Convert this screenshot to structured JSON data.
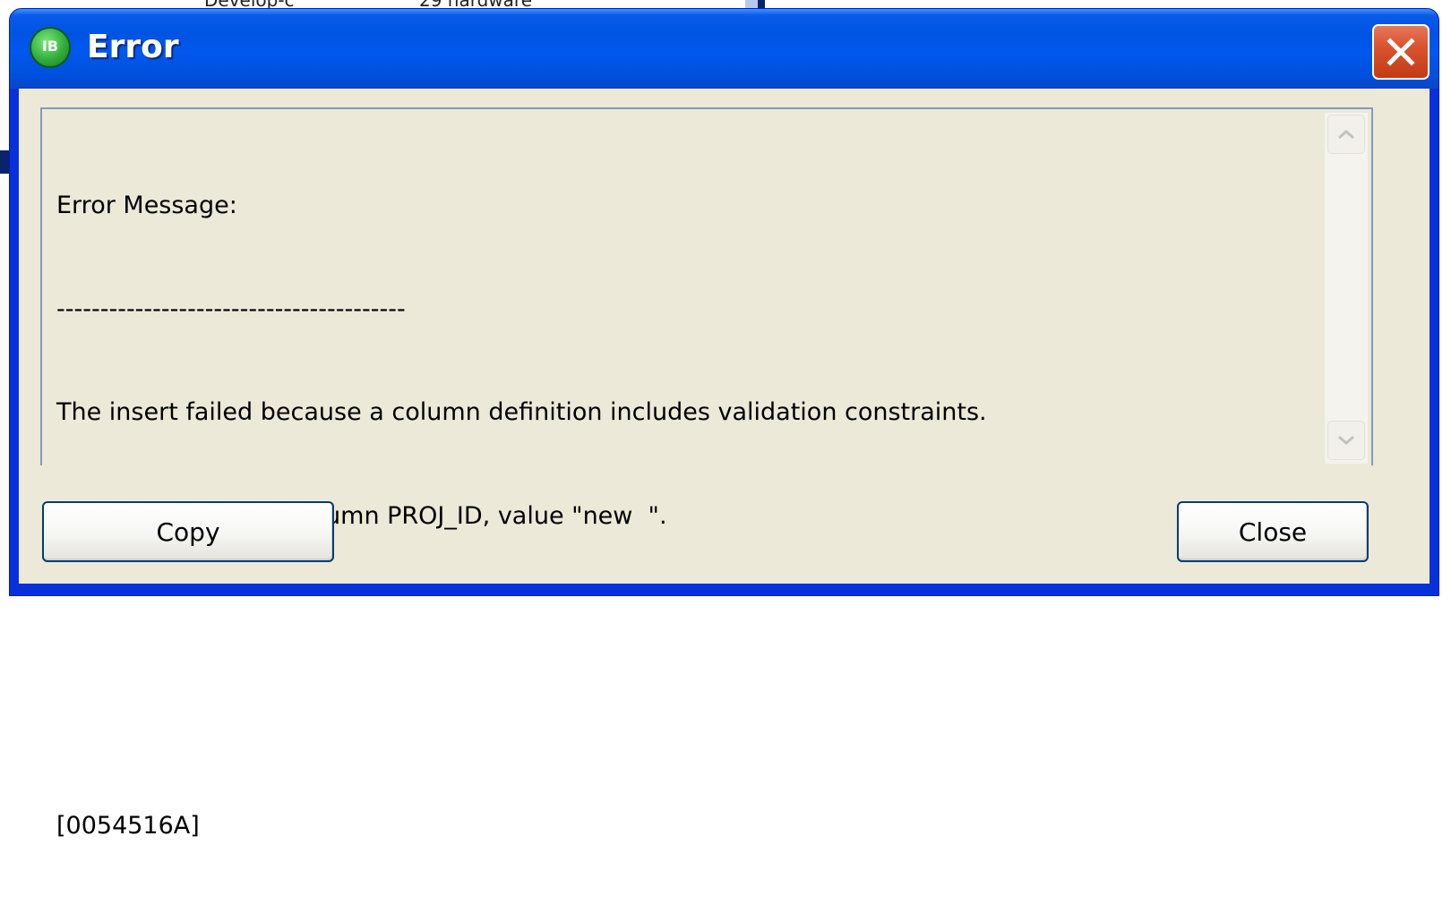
{
  "background": {
    "partial_cells": [
      "Develop-c",
      "29 hardware"
    ]
  },
  "dialog": {
    "title": "Error",
    "icon": "ib-app-icon",
    "close_icon": "close-x-icon",
    "message_lines": [
      "Error Message:",
      "----------------------------------------",
      "The insert failed because a column definition includes validation constraints.",
      "validation error for column PROJ_ID, value \"new  \".",
      "",
      "",
      "[0054516A]"
    ],
    "buttons": {
      "copy": "Copy",
      "close": "Close"
    },
    "colors": {
      "titlebar": "#0054e3",
      "client": "#ece9d8",
      "close_button": "#d8542f"
    }
  }
}
